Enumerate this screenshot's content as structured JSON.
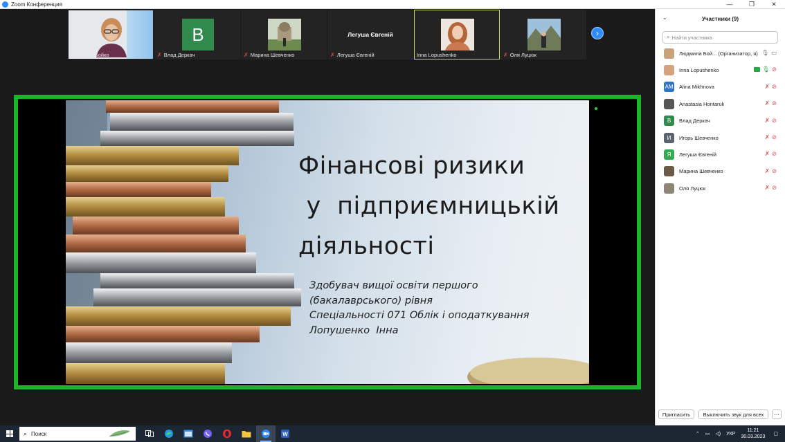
{
  "window": {
    "title": "Zoom Конференция",
    "controls": [
      "—",
      "❐",
      "✕"
    ]
  },
  "gallery": [
    {
      "name": "Людмила Бойко",
      "muted": false,
      "kind": "video-woman-glasses"
    },
    {
      "name": "Влад Деркач",
      "muted": true,
      "kind": "letter",
      "letter": "B",
      "color": "#2f8a4c"
    },
    {
      "name": "Марина Шевченко",
      "muted": true,
      "kind": "photo-cathedral"
    },
    {
      "name": "Легуша Євгеній",
      "muted": true,
      "kind": "name-only"
    },
    {
      "name": "Inna Lopushenko",
      "muted": false,
      "kind": "photo-redhair",
      "active": true
    },
    {
      "name": "Оля Луцюк",
      "muted": true,
      "kind": "photo-landscape"
    }
  ],
  "slide": {
    "title_lines": [
      "Фінансові ризики",
      " у  підприємницькій",
      "діяльності"
    ],
    "subtitle_lines": [
      "Здобувач вищої освіти першого",
      "(бакалаврського) рівня",
      "Спеціальності 071 Облік і оподаткування",
      "Лопушенко  Інна"
    ]
  },
  "participants": {
    "header": "Участники (9)",
    "search_placeholder": "Найти участника",
    "list": [
      {
        "name": "Людмила Бой... (Организатор, я)",
        "avatar": "photo",
        "color": "#c9a27a",
        "mic": "on-grey",
        "cam": "grey"
      },
      {
        "name": "Inna Lopushenko",
        "avatar": "photo",
        "color": "#d7a17d",
        "mic": "on",
        "cam": "off",
        "video_on": true
      },
      {
        "name": "Alina Mikhnova",
        "avatar": "AM",
        "color": "#2f74c0",
        "mic": "off",
        "cam": "off"
      },
      {
        "name": "Anastasia Hontaruk",
        "avatar": "photo",
        "color": "#555555",
        "mic": "off",
        "cam": "off"
      },
      {
        "name": "Влад Деркач",
        "avatar": "B",
        "color": "#2f8a4c",
        "mic": "off",
        "cam": "off"
      },
      {
        "name": "Игорь Шевченко",
        "avatar": "И",
        "color": "#5a6470",
        "mic": "off",
        "cam": "off"
      },
      {
        "name": "Легуша Євгеній",
        "avatar": "Я",
        "color": "#34a853",
        "mic": "off",
        "cam": "off"
      },
      {
        "name": "Марина Шевченко",
        "avatar": "photo",
        "color": "#6b5a45",
        "mic": "off",
        "cam": "off"
      },
      {
        "name": "Оля Луцюк",
        "avatar": "photo",
        "color": "#8f8575",
        "mic": "off",
        "cam": "off"
      }
    ],
    "invite_label": "Пригласить",
    "mute_all_label": "Выключить звук для всех",
    "more_label": "···"
  },
  "taskbar": {
    "search_label": "Поиск",
    "language": "УКР",
    "time": "11:21",
    "date": "30.03.2023"
  }
}
